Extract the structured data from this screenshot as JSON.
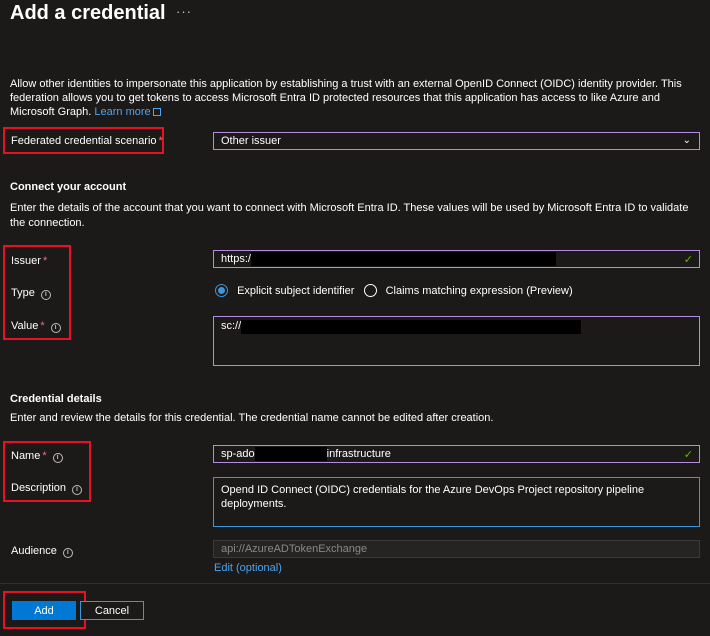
{
  "header": {
    "title": "Add a credential",
    "more_glyph": "···"
  },
  "intro": {
    "text": "Allow other identities to impersonate this application by establishing a trust with an external OpenID Connect (OIDC) identity provider. This federation allows you to get tokens to access Microsoft Entra ID protected resources that this application has access to like Azure and Microsoft Graph.",
    "learn_more": "Learn more"
  },
  "scenario": {
    "label": "Federated credential scenario",
    "required": "*",
    "value": "Other issuer"
  },
  "connect": {
    "heading": "Connect your account",
    "description": "Enter the details of the account that you want to connect with Microsoft Entra ID. These values will be used by Microsoft Entra ID to validate the connection."
  },
  "issuer": {
    "label": "Issuer",
    "required": "*",
    "value": "https:/"
  },
  "type": {
    "label": "Type",
    "options": [
      "Explicit subject identifier",
      "Claims matching expression (Preview)"
    ],
    "selected": "Explicit subject identifier"
  },
  "value_field": {
    "label": "Value",
    "required": "*",
    "value": "sc://"
  },
  "credential": {
    "heading": "Credential details",
    "description": "Enter and review the details for this credential. The credential name cannot be edited after creation."
  },
  "name": {
    "label": "Name",
    "required": "*",
    "value_prefix": "sp-ado",
    "value_suffix": "infrastructure"
  },
  "description_field": {
    "label": "Description",
    "value": "Opend ID Connect (OIDC) credentials for the Azure DevOps Project repository pipeline deployments."
  },
  "audience": {
    "label": "Audience",
    "value": "api://AzureADTokenExchange",
    "edit_link": "Edit (optional)"
  },
  "footer": {
    "add_label": "Add",
    "cancel_label": "Cancel"
  },
  "colors": {
    "background": "#1b1a19",
    "accent": "#0078d4",
    "highlight_box": "#e81123",
    "field_border": "#b48ce0",
    "valid_check": "#6bb700"
  }
}
